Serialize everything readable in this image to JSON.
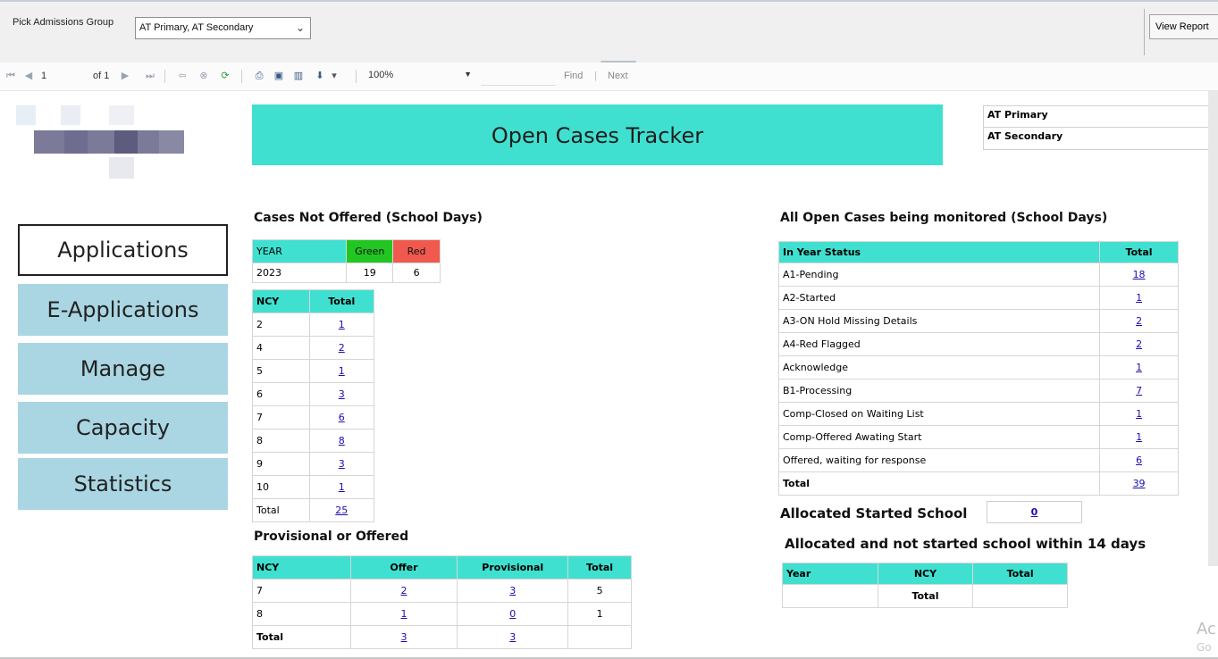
{
  "params": {
    "label": "Pick Admissions Group",
    "selected": "AT Primary, AT Secondary",
    "view_report": "View Report"
  },
  "toolbar": {
    "page": "1",
    "of_pages": "of 1",
    "zoom": "100%",
    "find": "Find",
    "sep": "|",
    "next": "Next"
  },
  "report": {
    "title": "Open Cases Tracker",
    "groups": [
      "AT Primary",
      "AT Secondary"
    ]
  },
  "nav": [
    "Applications",
    "E-Applications",
    "Manage",
    "Capacity",
    "Statistics"
  ],
  "not_offered": {
    "title": "Cases Not Offered (School Days)",
    "year_header": "YEAR",
    "green_header": "Green",
    "red_header": "Red",
    "year": "2023",
    "green": "19",
    "red": "6",
    "ncy_header": "NCY",
    "total_header": "Total",
    "rows": [
      {
        "ncy": "2",
        "total": "1"
      },
      {
        "ncy": "4",
        "total": "2"
      },
      {
        "ncy": "5",
        "total": "1"
      },
      {
        "ncy": "6",
        "total": "3"
      },
      {
        "ncy": "7",
        "total": "6"
      },
      {
        "ncy": "8",
        "total": "8"
      },
      {
        "ncy": "9",
        "total": "3"
      },
      {
        "ncy": "10",
        "total": "1"
      },
      {
        "ncy": "Total",
        "total": "25"
      }
    ]
  },
  "provisional": {
    "title": "Provisional or Offered",
    "headers": [
      "NCY",
      "Offer",
      "Provisional",
      "Total"
    ],
    "rows": [
      {
        "ncy": "7",
        "offer": "2",
        "provisional": "3",
        "total": "5"
      },
      {
        "ncy": "8",
        "offer": "1",
        "provisional": "0",
        "total": "1"
      },
      {
        "ncy": "Total",
        "offer": "3",
        "provisional": "3",
        "total": ""
      }
    ]
  },
  "monitored": {
    "title": "All Open Cases being monitored (School Days)",
    "status_header": "In Year Status",
    "total_header": "Total",
    "rows": [
      {
        "status": "A1-Pending",
        "total": "18"
      },
      {
        "status": "A2-Started",
        "total": "1"
      },
      {
        "status": "A3-ON Hold Missing Details",
        "total": "2"
      },
      {
        "status": "A4-Red Flagged",
        "total": "2"
      },
      {
        "status": "Acknowledge",
        "total": "1"
      },
      {
        "status": "B1-Processing",
        "total": "7"
      },
      {
        "status": "Comp-Closed on Waiting List",
        "total": "1"
      },
      {
        "status": "Comp-Offered Awating Start",
        "total": "1"
      },
      {
        "status": "Offered, waiting for response",
        "total": "6"
      },
      {
        "status": "Total",
        "total": "39"
      }
    ]
  },
  "allocated": {
    "label": "Allocated Started School",
    "value": "0",
    "not_started_title": "Allocated and not started school within 14 days",
    "headers": [
      "Year",
      "NCY",
      "Total"
    ],
    "total_label": "Total"
  },
  "watermark": {
    "line1": "Ac",
    "line2": "Go"
  },
  "colors": {
    "teal": "#40e0d0",
    "nav": "#a9d6e2",
    "green": "#22c622",
    "red": "#f05a4e",
    "link": "#1a0dab"
  }
}
